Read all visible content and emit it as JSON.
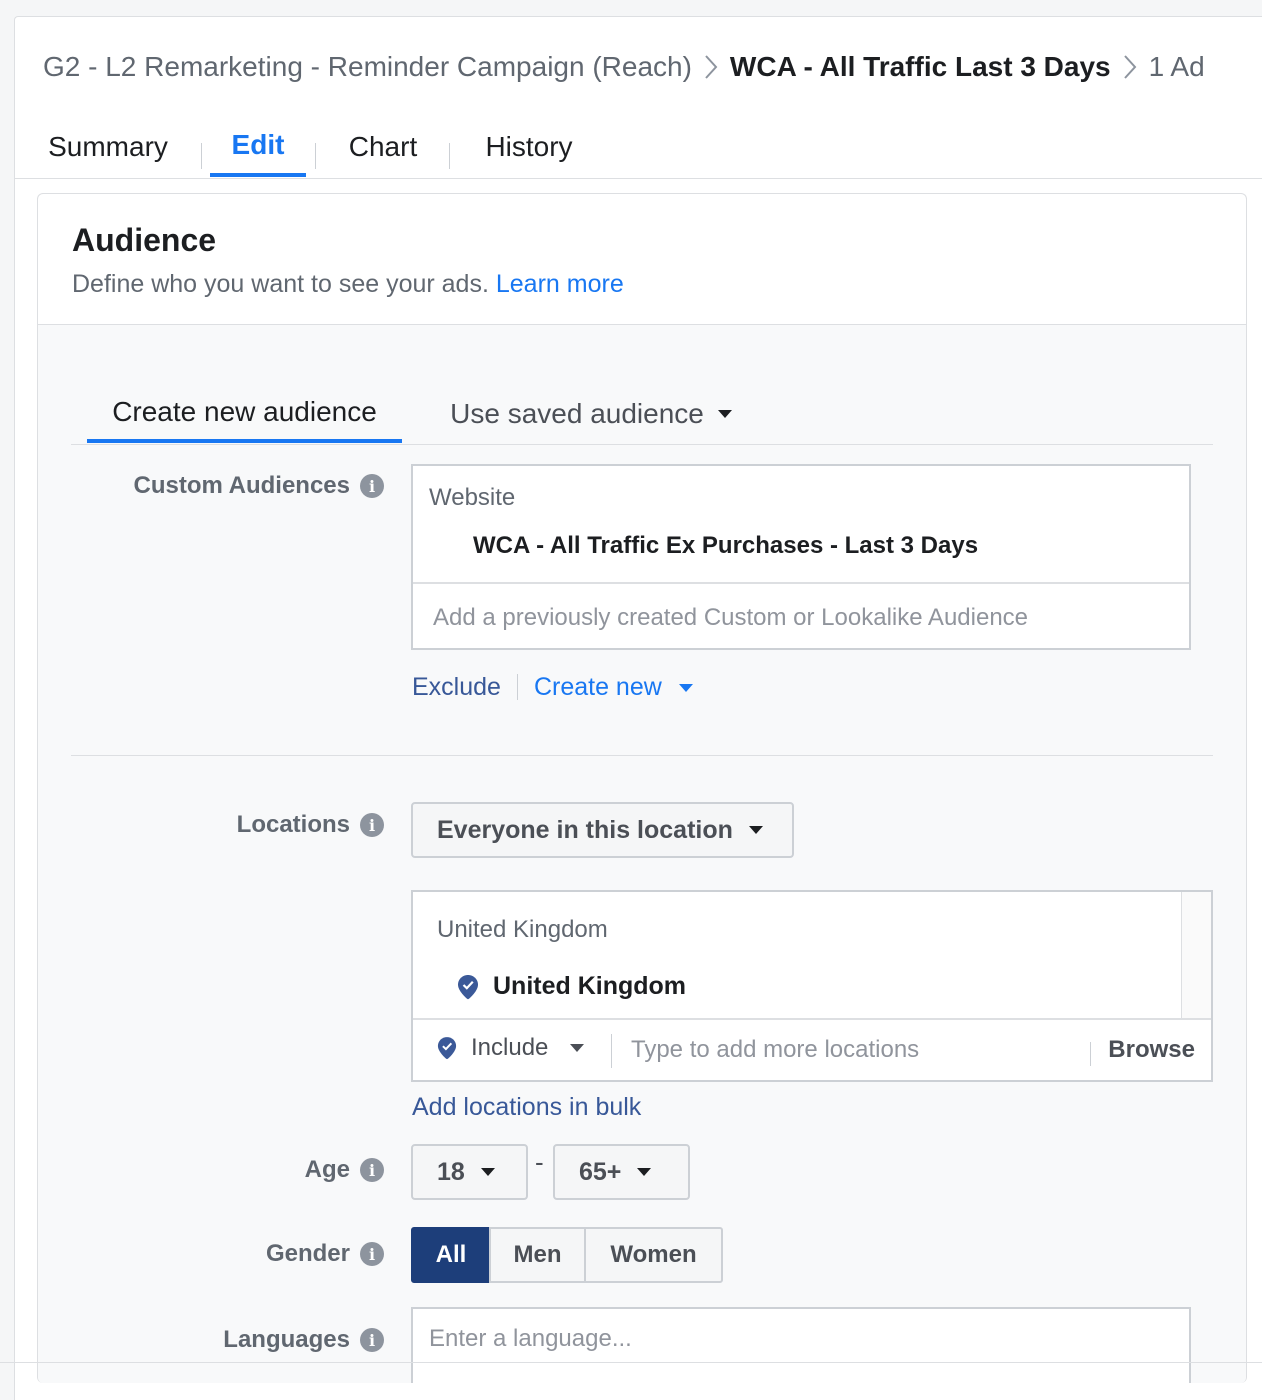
{
  "breadcrumb": {
    "campaign": "G2 - L2 Remarketing - Reminder Campaign (Reach)",
    "ad_set": "WCA - All Traffic Last 3 Days",
    "ads": "1 Ad"
  },
  "tabs": [
    {
      "label": "Summary"
    },
    {
      "label": "Edit",
      "active": true
    },
    {
      "label": "Chart"
    },
    {
      "label": "History"
    }
  ],
  "audience": {
    "title": "Audience",
    "description": "Define who you want to see your ads.",
    "learn_more": "Learn more",
    "tabs": {
      "create_new": "Create new audience",
      "use_saved": "Use saved audience"
    },
    "custom_audiences": {
      "label": "Custom Audiences",
      "category": "Website",
      "selected_item": "WCA - All Traffic Ex Purchases - Last 3 Days",
      "placeholder": "Add a previously created Custom or Lookalike Audience",
      "exclude_link": "Exclude",
      "create_new_link": "Create new"
    },
    "locations": {
      "label": "Locations",
      "type_dropdown": "Everyone in this location",
      "group_heading": "United Kingdom",
      "selected": "United Kingdom",
      "include_label": "Include",
      "placeholder": "Type to add more locations",
      "browse": "Browse",
      "bulk_link": "Add locations in bulk"
    },
    "age": {
      "label": "Age",
      "min": "18",
      "separator": "-",
      "max": "65+"
    },
    "gender": {
      "label": "Gender",
      "options": [
        "All",
        "Men",
        "Women"
      ],
      "selected": "All"
    },
    "languages": {
      "label": "Languages",
      "placeholder": "Enter a language..."
    }
  },
  "colors": {
    "accent": "#1877f2",
    "selected_gender": "#1d3e7a",
    "link": "#1877f2"
  }
}
